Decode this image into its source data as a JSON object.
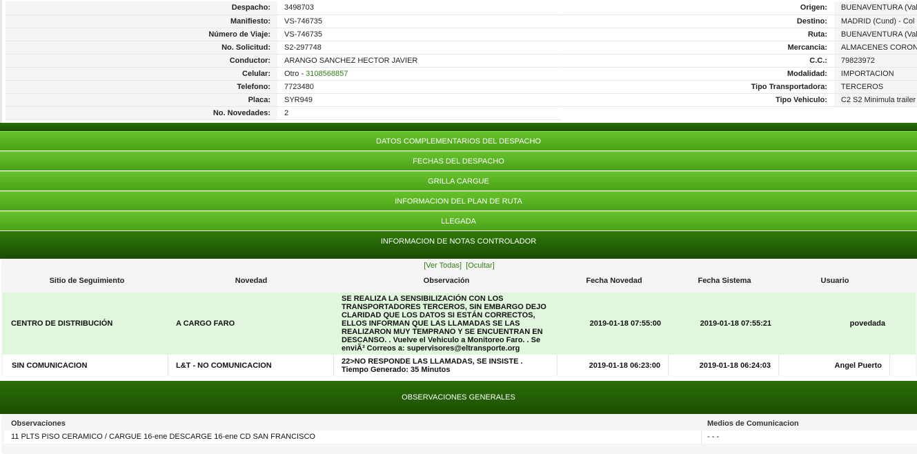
{
  "dispatch_left": [
    {
      "label": "Despacho:",
      "value": "3498703"
    },
    {
      "label": "Manifiesto:",
      "value": "VS-746735"
    },
    {
      "label": "Número de Viaje:",
      "value": "VS-746735"
    },
    {
      "label": "No. Solicitud:",
      "value": "S2-297748"
    },
    {
      "label": "Conductor:",
      "value": "ARANGO SANCHEZ HECTOR JAVIER"
    },
    {
      "label": "Celular:",
      "value_prefix": "Otro - ",
      "value": "3108568857"
    },
    {
      "label": "Telefono:",
      "value": "7723480"
    },
    {
      "label": "Placa:",
      "value": "SYR949"
    },
    {
      "label": "No. Novedades:",
      "value": "2"
    }
  ],
  "dispatch_right": [
    {
      "label": "Origen:",
      "value": "BUENAVENTURA (Val"
    },
    {
      "label": "Destino:",
      "value": "MADRID (Cund) - Col -"
    },
    {
      "label": "Ruta:",
      "value": "BUENAVENTURA (Val"
    },
    {
      "label": "Mercancia:",
      "value": "ALMACENES CORON"
    },
    {
      "label": "C.C.:",
      "value": "79823972"
    },
    {
      "label": "Modalidad:",
      "value": "IMPORTACION"
    },
    {
      "label": "Tipo Transportadora:",
      "value": "TERCEROS"
    },
    {
      "label": "Tipo Vehiculo:",
      "value": "C2 S2 Minimula trailer"
    }
  ],
  "sections": {
    "complementarios": "DATOS COMPLEMENTARIOS DEL DESPACHO",
    "fechas": "FECHAS DEL DESPACHO",
    "grilla": "GRILLA CARGUE",
    "plan_ruta": "INFORMACION DEL PLAN DE RUTA",
    "llegada": "LLEGADA",
    "notas": "INFORMACION DE NOTAS CONTROLADOR",
    "observaciones": "OBSERVACIONES GENERALES"
  },
  "notes": {
    "ver_todas": "[Ver Todas]",
    "ocultar": "[Ocultar]",
    "headers": {
      "sitio": "Sitio de Seguimiento",
      "novedad": "Novedad",
      "observacion": "Observación",
      "fecha_novedad": "Fecha Novedad",
      "fecha_sistema": "Fecha Sistema",
      "usuario": "Usuario"
    },
    "rows": [
      {
        "sitio": "CENTRO DE DISTRIBUCIÓN",
        "novedad": "A CARGO FARO",
        "observacion": "SE REALIZA LA SENSIBILIZACIÓN CON LOS TRANSPORTADORES TERCEROS, SIN EMBARGO DEJO CLARIDAD QUE LOS DATOS SI ESTÁN CORRECTOS, ELLOS INFORMAN QUE LAS LLAMADAS SE LAS REALIZARON MUY TEMPRANO Y SE ENCUENTRAN EN DESCANSO. . Vuelve el Vehiculo a Monitoreo Faro. . Se enviÃ³ Correos a: supervisores@eltransporte.org",
        "fecha_novedad": "2019-01-18 07:55:00",
        "fecha_sistema": "2019-01-18 07:55:21",
        "usuario": "povedada"
      },
      {
        "sitio": "SIN COMUNICACION",
        "novedad": "L&T - NO COMUNICACION",
        "observacion": "22>NO RESPONDE LAS LLAMADAS, SE INSISTE . Tiempo Generado: 35 Minutos",
        "fecha_novedad": "2019-01-18 06:23:00",
        "fecha_sistema": "2019-01-18 06:24:03",
        "usuario": "Angel Puerto"
      }
    ]
  },
  "observaciones": {
    "header_obs": "Observaciones",
    "header_medios": "Medios de Comunicacion",
    "text": "11 PLTS PISO CERAMICO / CARGUE 16-ene DESCARGE 16-ene CD SAN FRANCISCO",
    "medios": "- - -"
  }
}
